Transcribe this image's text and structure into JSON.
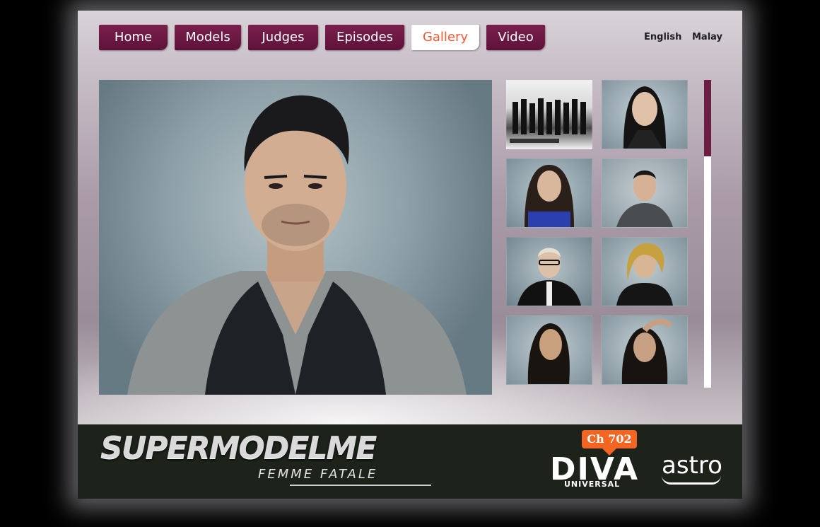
{
  "nav": {
    "items": [
      {
        "label": "Home"
      },
      {
        "label": "Models"
      },
      {
        "label": "Judges"
      },
      {
        "label": "Episodes"
      },
      {
        "label": "Gallery",
        "active": true
      },
      {
        "label": "Video"
      }
    ]
  },
  "language": {
    "english": "English",
    "malay": "Malay"
  },
  "gallery": {
    "scroll_position": 0.0
  },
  "footer": {
    "brand_title": "SUPERMODELME",
    "brand_subtitle": "FEMME FATALE",
    "channel_badge": "Ch 702",
    "channel_name": "DIVA",
    "channel_sub": "UNIVERSAL",
    "provider": "astro"
  },
  "colors": {
    "nav_bg": "#6a1a43",
    "nav_active_text": "#f25a35",
    "badge": "#f26522"
  }
}
